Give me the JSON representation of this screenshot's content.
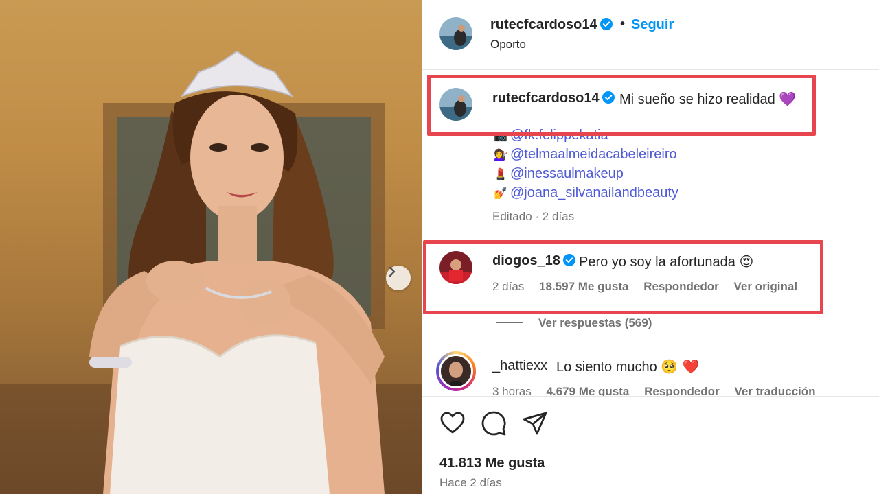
{
  "post": {
    "username": "rutecfcardoso14",
    "follow_label": "Seguir",
    "separator": "•",
    "location": "Oporto"
  },
  "caption": {
    "username": "rutecfcardoso14",
    "text": "Mi sueño se hizo realidad",
    "text_emoji": "💜",
    "tags": [
      {
        "emoji": "📷",
        "handle": "@fk.felippekatia"
      },
      {
        "emoji": "💇‍♀️",
        "handle": "@telmaalmeidacabeleireiro"
      },
      {
        "emoji": "💄",
        "handle": "@inessaulmakeup"
      },
      {
        "emoji": "💅",
        "handle": "@joana_silvanailandbeauty"
      }
    ],
    "edited": "Editado",
    "time": "· 2 días"
  },
  "comment1": {
    "username": "diogos_18",
    "text": "Pero yo soy la afortunada",
    "emoji": "😍",
    "time": "2 días",
    "likes": "18.597 Me gusta",
    "reply": "Respondedor",
    "original": "Ver original",
    "view_replies": "Ver respuestas (569)"
  },
  "comment2": {
    "username": "_hattiexx",
    "text": "Lo siento mucho",
    "emoji": "🥺 ❤️",
    "time": "3 horas",
    "likes": "4.679 Me gusta",
    "reply": "Respondedor",
    "translate": "Ver traducción"
  },
  "footer": {
    "likes": "41.813 Me gusta",
    "ago": "Hace 2 días"
  },
  "icons": [
    "heart-icon",
    "comment-icon",
    "share-icon",
    "verified-icon",
    "chevron-right-icon"
  ],
  "colors": {
    "accent_blue": "#0095f6",
    "tag_link": "#4f5bd5",
    "highlight_red": "#e8464e",
    "muted_text": "#737373"
  }
}
